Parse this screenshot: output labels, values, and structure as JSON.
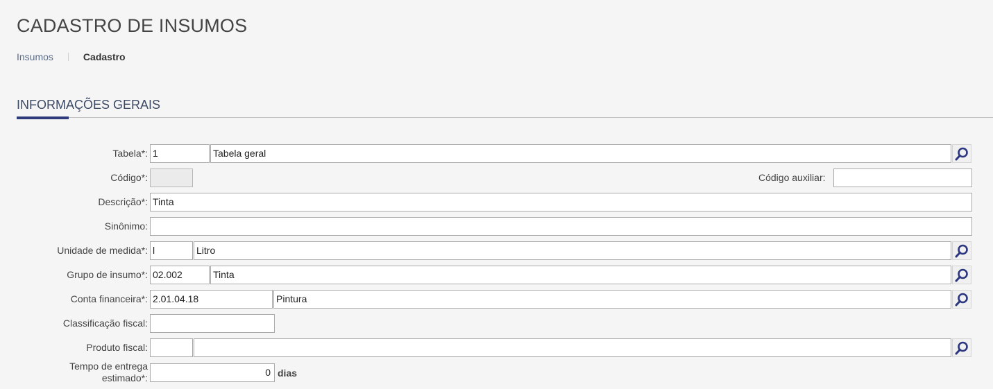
{
  "page": {
    "title": "CADASTRO DE INSUMOS"
  },
  "breadcrumb": {
    "items": [
      "Insumos"
    ],
    "current": "Cadastro"
  },
  "section": {
    "title": "INFORMAÇÕES GERAIS"
  },
  "form": {
    "tabela": {
      "label": "Tabela*:",
      "code": "1",
      "description": "Tabela geral"
    },
    "codigo": {
      "label": "Código*:",
      "value": ""
    },
    "codigo_auxiliar": {
      "label": "Código auxiliar:",
      "value": ""
    },
    "descricao": {
      "label": "Descrição*:",
      "value": "Tinta"
    },
    "sinonimo": {
      "label": "Sinônimo:",
      "value": ""
    },
    "unidade_medida": {
      "label": "Unidade de medida*:",
      "code": "l",
      "description": "Litro"
    },
    "grupo_insumo": {
      "label": "Grupo de insumo*:",
      "code": "02.002",
      "description": "Tinta"
    },
    "conta_financeira": {
      "label": "Conta financeira*:",
      "code": "2.01.04.18",
      "description": "Pintura"
    },
    "classificacao_fiscal": {
      "label": "Classificação fiscal:",
      "value": ""
    },
    "produto_fiscal": {
      "label": "Produto fiscal:",
      "code": "",
      "description": ""
    },
    "tempo_entrega": {
      "label": "Tempo de entrega estimado*:",
      "value": "0",
      "suffix": "dias"
    }
  },
  "icons": {
    "search": "search-icon"
  },
  "colors": {
    "accent": "#2f3a7a",
    "search_icon": "#2b3580",
    "link": "#5a6b87"
  }
}
